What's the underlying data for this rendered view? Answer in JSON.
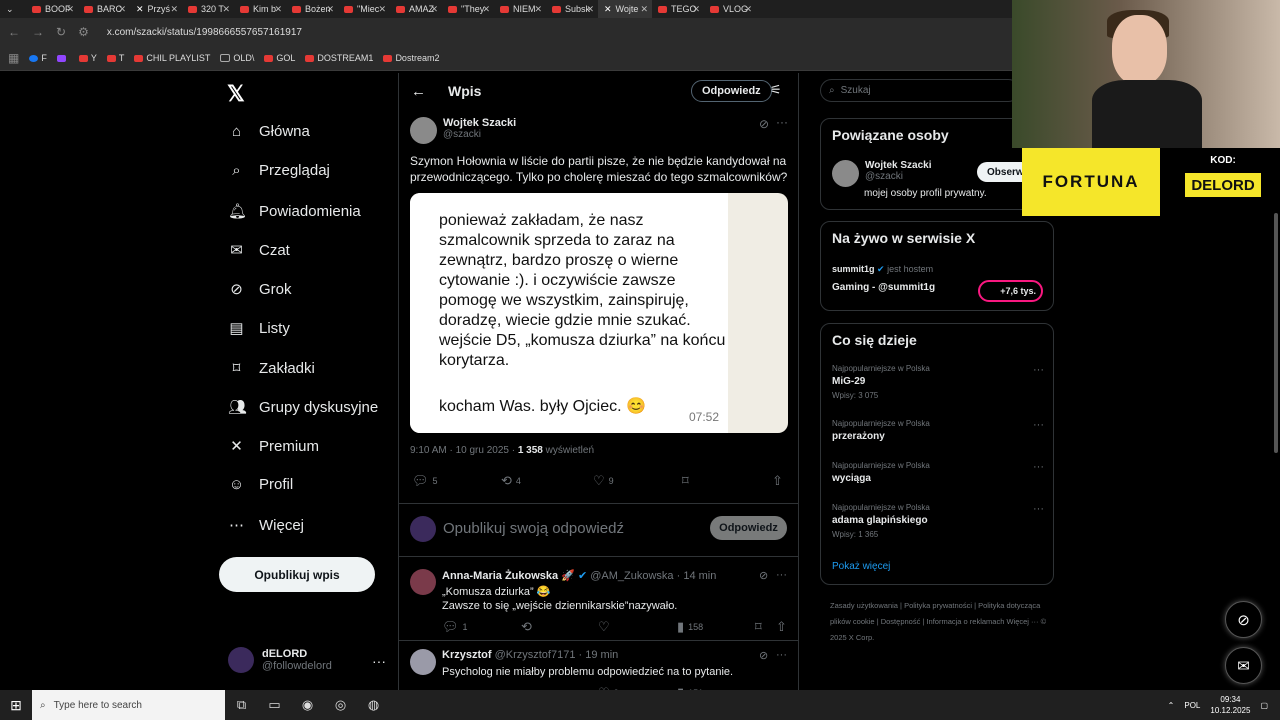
{
  "browser": {
    "tabs": [
      "BOOF",
      "BARC",
      "Przyś",
      "320 T",
      "Kim b",
      "Bożen",
      "\"Miec",
      "AMAZ",
      "\"They",
      "NIEM",
      "Subsk",
      "Wojte",
      "TEGO",
      "VLOG"
    ],
    "active_tab_index": 11,
    "url": "x.com/szacki/status/1998666557657161917",
    "bookmarks": [
      "F",
      "",
      "Y",
      "T",
      "CHIL PLAYLIST",
      "OLD\\",
      "GOL",
      "DOSTREAM1",
      "Dostream2"
    ]
  },
  "sidebar": {
    "items": [
      {
        "label": "Główna",
        "icon": "home-icon",
        "glyph": "⌂"
      },
      {
        "label": "Przeglądaj",
        "icon": "search-icon",
        "glyph": "⌕"
      },
      {
        "label": "Powiadomienia",
        "icon": "bell-icon",
        "glyph": "🔔︎"
      },
      {
        "label": "Czat",
        "icon": "mail-icon",
        "glyph": "✉"
      },
      {
        "label": "Grok",
        "icon": "grok-icon",
        "glyph": "⊘"
      },
      {
        "label": "Listy",
        "icon": "list-icon",
        "glyph": "▤"
      },
      {
        "label": "Zakładki",
        "icon": "bookmark-icon",
        "glyph": "⌑"
      },
      {
        "label": "Grupy dyskusyjne",
        "icon": "communities-icon",
        "glyph": "👥︎"
      },
      {
        "label": "Premium",
        "icon": "x-premium-icon",
        "glyph": "✕"
      },
      {
        "label": "Profil",
        "icon": "person-icon",
        "glyph": "☺"
      },
      {
        "label": "Więcej",
        "icon": "more-circle-icon",
        "glyph": "⋯"
      }
    ],
    "post_button": "Opublikuj wpis",
    "account": {
      "name": "dELORD",
      "handle": "@followdelord"
    }
  },
  "post_page": {
    "title": "Wpis",
    "reply_button": "Odpowiedz",
    "author": {
      "name": "Wojtek Szacki",
      "handle": "@szacki"
    },
    "text": "Szymon Hołownia w liście do partii pisze, że nie będzie kandydował na przewodniczącego. Tylko po cholerę mieszać do tego szmalcowników?",
    "image": {
      "message": "ponieważ zakładam, że nasz szmalcownik sprzeda to zaraz na zewnątrz, bardzo proszę o wierne cytowanie :). i oczywiście zawsze pomogę we wszystkim, zainspiruję, doradzę, wiecie gdzie mnie szukać. wejście D5, „komusza dziurka” na końcu korytarza.",
      "closing": "kocham Was. były Ojciec. 😊",
      "time": "07:52"
    },
    "meta_date": "9:10 AM · 10 gru 2025 · ",
    "meta_views": "1 358",
    "meta_views_label": " wyświetleń",
    "stats": {
      "replies": "5",
      "reposts": "4",
      "likes": "9"
    },
    "compose_placeholder": "Opublikuj swoją odpowiedź",
    "compose_button": "Odpowiedz"
  },
  "replies": [
    {
      "name": "Anna-Maria Żukowska 🚀",
      "handle": "@AM_Zukowska",
      "time": "· 14 min",
      "line1": "„Komusza dziurka” 😂",
      "line2": "Zawsze to się „wejście dziennikarskie”nazywało.",
      "replies": "1",
      "likes": "",
      "views": "158"
    },
    {
      "name": "Krzysztof",
      "handle": "@Krzysztof7171",
      "time": "· 19 min",
      "line1": "Psycholog nie miałby problemu odpowiedzieć na to pytanie.",
      "line2": "",
      "replies": "",
      "likes": "2",
      "views": "151"
    }
  ],
  "right": {
    "search_placeholder": "Szukaj",
    "related_title": "Powiązane osoby",
    "related": {
      "name": "Wojtek Szacki",
      "handle": "@szacki",
      "bio": "mojej osoby profil prywatny.",
      "follow": "Obserw"
    },
    "live_title": "Na żywo w serwisie X",
    "live": {
      "host": "summit1g",
      "host_suffix": " jest hostem",
      "title": "Gaming - @summit1g",
      "viewers": "+7,6 tys."
    },
    "trends_title": "Co się dzieje",
    "trends": [
      {
        "category": "Najpopularniejsze w Polska",
        "name": "MiG-29",
        "count": "Wpisy: 3 075"
      },
      {
        "category": "Najpopularniejsze w Polska",
        "name": "przerażony",
        "count": ""
      },
      {
        "category": "Najpopularniejsze w Polska",
        "name": "wyciąga",
        "count": ""
      },
      {
        "category": "Najpopularniejsze w Polska",
        "name": "adama glapińskiego",
        "count": "Wpisy: 1 365"
      }
    ],
    "show_more": "Pokaż więcej",
    "footer": "Zasady użytkowania  |  Polityka prywatności  |  Polityka dotycząca plików cookie  |  Dostępność  |  Informacja o reklamach   Więcej ···   © 2025 X Corp."
  },
  "overlay": {
    "sponsor": "FORTUNA",
    "code_label": "KOD:",
    "code": "DELORD"
  },
  "taskbar": {
    "search_placeholder": "Type here to search",
    "lang": "POL",
    "time": "09:34",
    "date": "10.12.2025"
  },
  "colors": {
    "accent": "#1d9bf0",
    "live_border": "#f91880",
    "sponsor": "#f5e62a"
  }
}
